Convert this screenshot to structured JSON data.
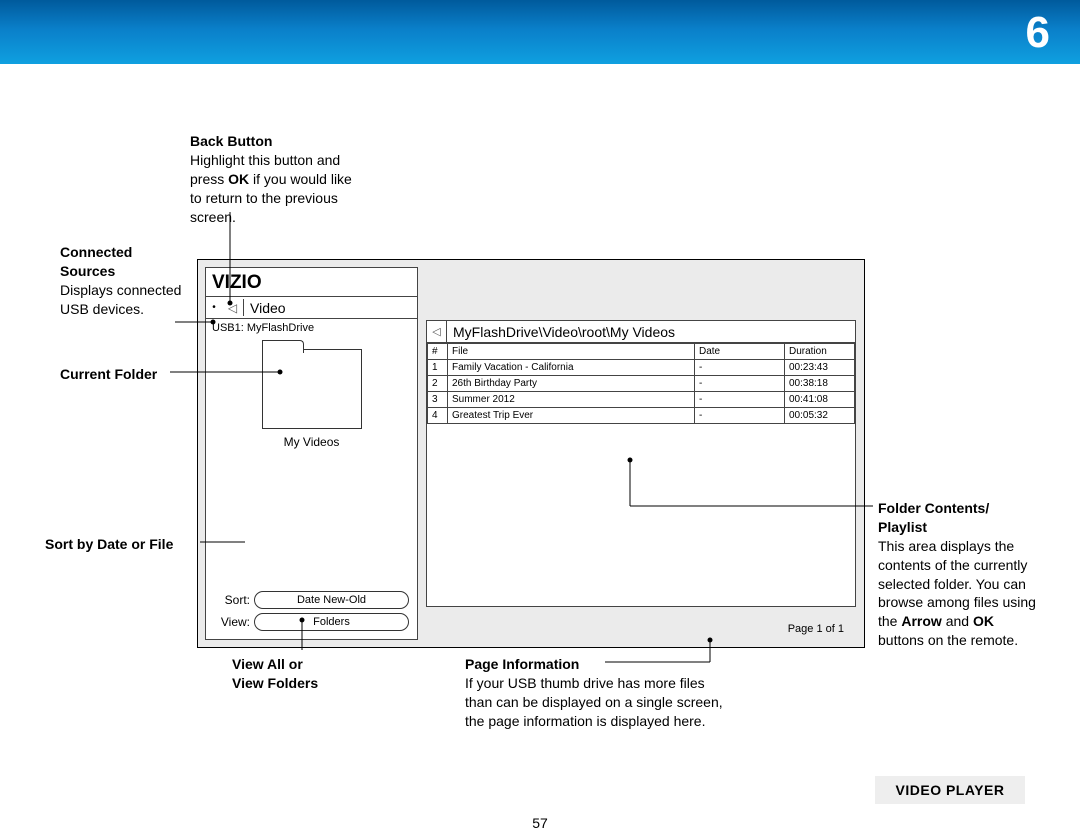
{
  "header": {
    "chapter_number": "6"
  },
  "page_number": "57",
  "caption": "VIDEO PLAYER",
  "screenshot": {
    "brand": "VIZIO",
    "video_label": "Video",
    "usb_source": "USB1: MyFlashDrive",
    "current_folder": "My Videos",
    "sort_label": "Sort:",
    "sort_value": "Date New-Old",
    "view_label": "View:",
    "view_value": "Folders",
    "breadcrumb_path": "MyFlashDrive\\Video\\root\\My Videos",
    "page_info": "Page 1 of 1",
    "table": {
      "headers": {
        "idx": "#",
        "file": "File",
        "date": "Date",
        "duration": "Duration"
      },
      "rows": [
        {
          "idx": "1",
          "file": "Family Vacation - California",
          "date": "-",
          "duration": "00:23:43"
        },
        {
          "idx": "2",
          "file": "26th Birthday Party",
          "date": "-",
          "duration": "00:38:18"
        },
        {
          "idx": "3",
          "file": "Summer 2012",
          "date": "-",
          "duration": "00:41:08"
        },
        {
          "idx": "4",
          "file": "Greatest Trip Ever",
          "date": "-",
          "duration": "00:05:32"
        }
      ]
    }
  },
  "callouts": {
    "back_button": {
      "title": "Back Button",
      "body_1": "Highlight this button and press ",
      "body_ok": "OK",
      "body_2": " if you would like to return to the previous screen."
    },
    "connected_sources": {
      "title_1": "Connected",
      "title_2": "Sources",
      "body": "Displays connected USB devices."
    },
    "current_folder": {
      "title": "Current Folder"
    },
    "sort_by": {
      "title": "Sort by Date or File"
    },
    "view_all": {
      "title_1": "View All or",
      "title_2": "View Folders"
    },
    "page_information": {
      "title": "Page Information",
      "body": "If your USB thumb drive has more files than can be displayed on a single screen, the page information is displayed here."
    },
    "folder_contents": {
      "title_1": "Folder Contents/",
      "title_2": "Playlist",
      "body_1": "This area displays the contents of the currently selected folder. You can browse among files using the ",
      "arrow": "Arrow",
      "body_2": " and ",
      "ok": "OK",
      "body_3": " buttons on the remote."
    }
  }
}
